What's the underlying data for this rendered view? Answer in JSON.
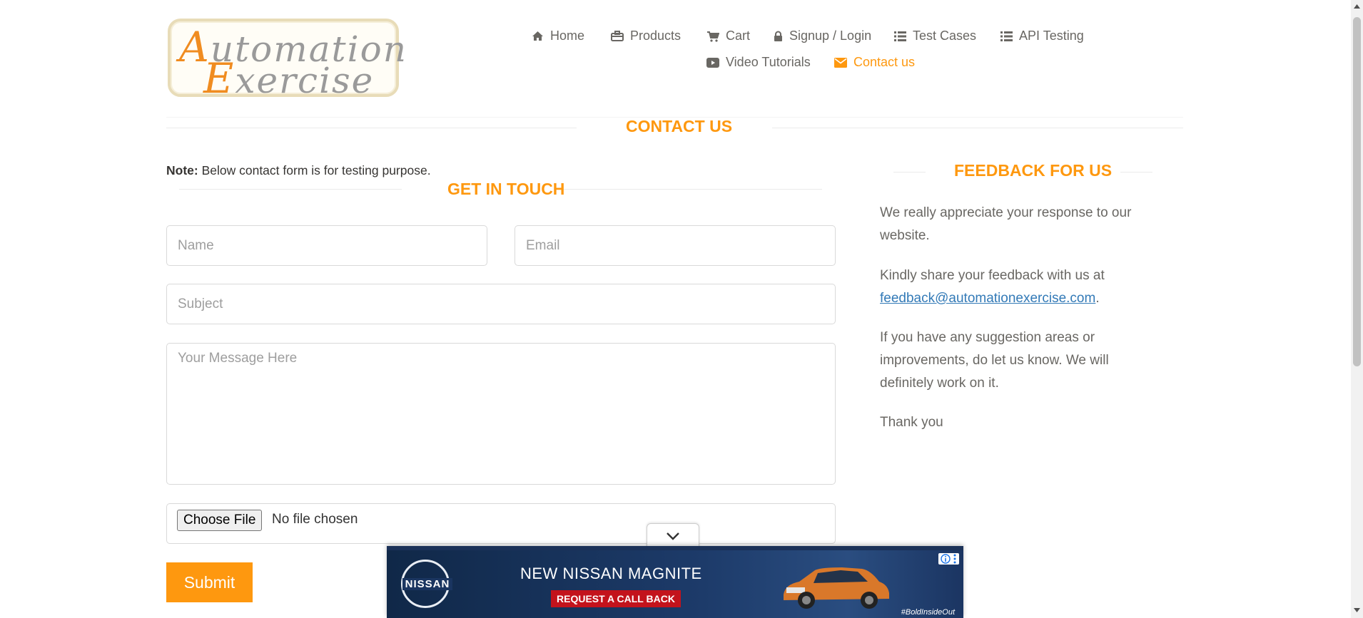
{
  "logo": {
    "line1_cap": "A",
    "line1_rest": "utomation",
    "line2_cap": "E",
    "line2_rest": "xercise"
  },
  "nav": {
    "items": [
      {
        "label": "Home",
        "icon": "home-icon"
      },
      {
        "label": "Products",
        "icon": "products-icon"
      },
      {
        "label": "Cart",
        "icon": "cart-icon"
      },
      {
        "label": "Signup / Login",
        "icon": "lock-icon"
      },
      {
        "label": "Test Cases",
        "icon": "list-icon"
      },
      {
        "label": "API Testing",
        "icon": "list-icon"
      },
      {
        "label": "Video Tutorials",
        "icon": "youtube-icon"
      },
      {
        "label": "Contact us",
        "icon": "envelope-icon",
        "active": true
      }
    ]
  },
  "page_title": "CONTACT US",
  "note": {
    "bold": "Note:",
    "text": " Below contact form is for testing purpose."
  },
  "form": {
    "heading": "GET IN TOUCH",
    "name_placeholder": "Name",
    "email_placeholder": "Email",
    "subject_placeholder": "Subject",
    "message_placeholder": "Your Message Here",
    "choose_file_label": "Choose File",
    "no_file_text": "No file chosen",
    "submit_label": "Submit"
  },
  "feedback": {
    "heading": "FEEDBACK FOR US",
    "p1": "We really appreciate your response to our website.",
    "p2_before": "Kindly share your feedback with us at ",
    "p2_link": "feedback@automationexercise.com",
    "p2_after": ".",
    "p3": "If you have any suggestion areas or improvements, do let us know. We will definitely work on it.",
    "p4": "Thank you"
  },
  "ad": {
    "brand": "NISSAN",
    "headline": "NEW NISSAN MAGNITE",
    "cta": "REQUEST A CALL BACK",
    "hashtag": "#BoldInsideOut"
  },
  "colors": {
    "accent": "#fe980f",
    "text": "#696763",
    "link": "#337ab7",
    "ad_bg": "#1b3158",
    "ad_cta": "#c3131c"
  }
}
